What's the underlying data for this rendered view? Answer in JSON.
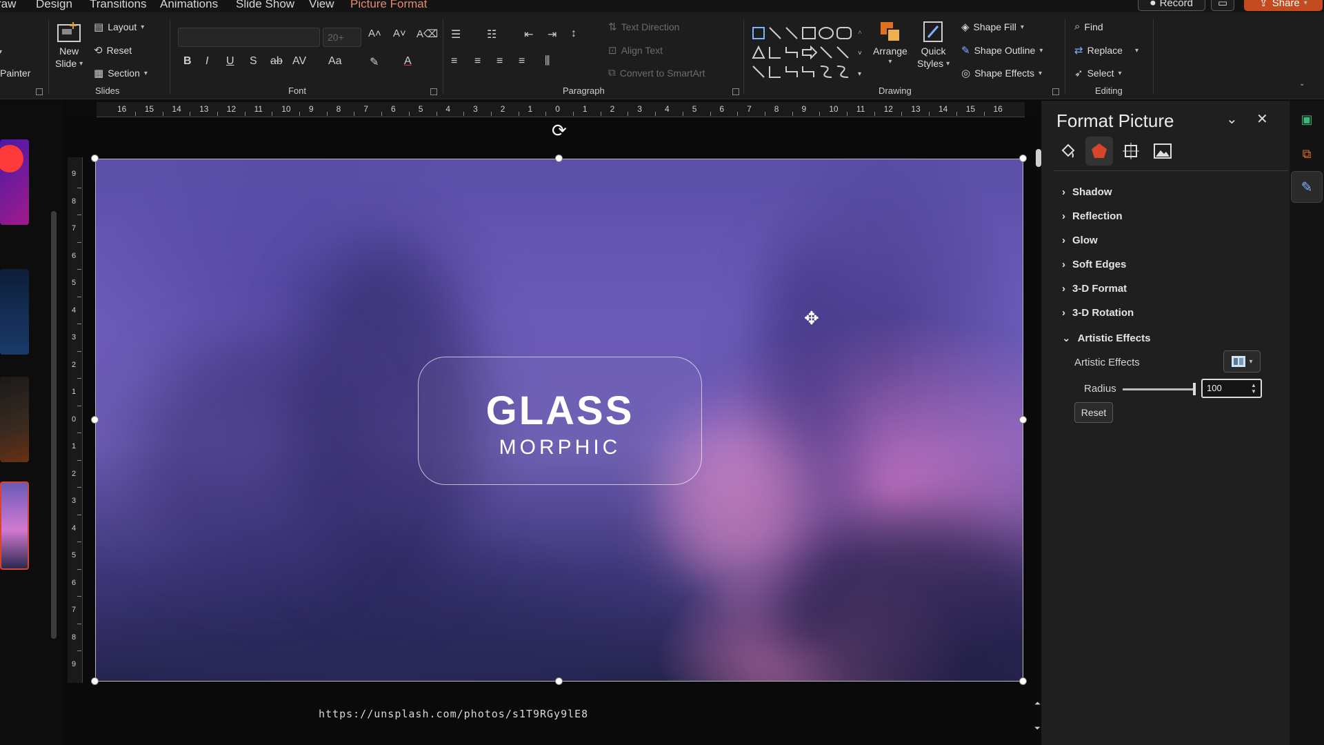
{
  "menu_tabs": [
    {
      "label": "raw",
      "active": false
    },
    {
      "label": "Design",
      "active": false
    },
    {
      "label": "Transitions",
      "active": false
    },
    {
      "label": "Animations",
      "active": false
    },
    {
      "label": "Slide Show",
      "active": false
    },
    {
      "label": "View",
      "active": false
    },
    {
      "label": "Picture Format",
      "active": true
    }
  ],
  "titlebar_buttons": {
    "record": "Record",
    "share": "Share"
  },
  "ribbon": {
    "clipboard": {
      "painter": "Painter"
    },
    "slides": {
      "new_slide_line1": "New",
      "new_slide_line2": "Slide",
      "layout": "Layout",
      "reset": "Reset",
      "section": "Section",
      "group_label": "Slides"
    },
    "font": {
      "name_value": "",
      "size_value": "20+",
      "group_label": "Font"
    },
    "paragraph": {
      "text_direction": "Text Direction",
      "align_text": "Align Text",
      "convert_smartart": "Convert to SmartArt",
      "group_label": "Paragraph"
    },
    "drawing": {
      "arrange": "Arrange",
      "quick_styles_line1": "Quick",
      "quick_styles_line2": "Styles",
      "shape_fill": "Shape Fill",
      "shape_outline": "Shape Outline",
      "shape_effects": "Shape Effects",
      "group_label": "Drawing"
    },
    "editing": {
      "find": "Find",
      "replace": "Replace",
      "select": "Select",
      "group_label": "Editing"
    }
  },
  "rulers": {
    "horizontal": [
      "16",
      "15",
      "14",
      "13",
      "12",
      "11",
      "10",
      "9",
      "8",
      "7",
      "6",
      "5",
      "4",
      "3",
      "2",
      "1",
      "0",
      "1",
      "2",
      "3",
      "4",
      "5",
      "6",
      "7",
      "8",
      "9",
      "10",
      "11",
      "12",
      "13",
      "14",
      "15",
      "16"
    ],
    "vertical": [
      "9",
      "8",
      "7",
      "6",
      "5",
      "4",
      "3",
      "2",
      "1",
      "0",
      "1",
      "2",
      "3",
      "4",
      "5",
      "6",
      "7",
      "8",
      "9"
    ]
  },
  "slide": {
    "title": "GLASS",
    "subtitle": "MORPHIC",
    "credit": "https://unsplash.com/photos/s1T9RGy9lE8",
    "colors": {
      "top": "#5b4fa8",
      "pink": "#eb82d2",
      "bottom": "#25244e"
    }
  },
  "format_pane": {
    "title": "Format Picture",
    "tabs": [
      "fill-line-icon",
      "effects-icon",
      "size-properties-icon",
      "picture-icon"
    ],
    "active_tab": 1,
    "sections": [
      {
        "label": "Shadow",
        "expanded": false
      },
      {
        "label": "Reflection",
        "expanded": false
      },
      {
        "label": "Glow",
        "expanded": false
      },
      {
        "label": "Soft Edges",
        "expanded": false
      },
      {
        "label": "3-D Format",
        "expanded": false
      },
      {
        "label": "3-D Rotation",
        "expanded": false
      },
      {
        "label": "Artistic Effects",
        "expanded": true
      }
    ],
    "artistic_effects_label": "Artistic Effects",
    "radius_label": "Radius",
    "radius_value": "100",
    "reset_label": "Reset",
    "accent_color": "#d9442c"
  }
}
